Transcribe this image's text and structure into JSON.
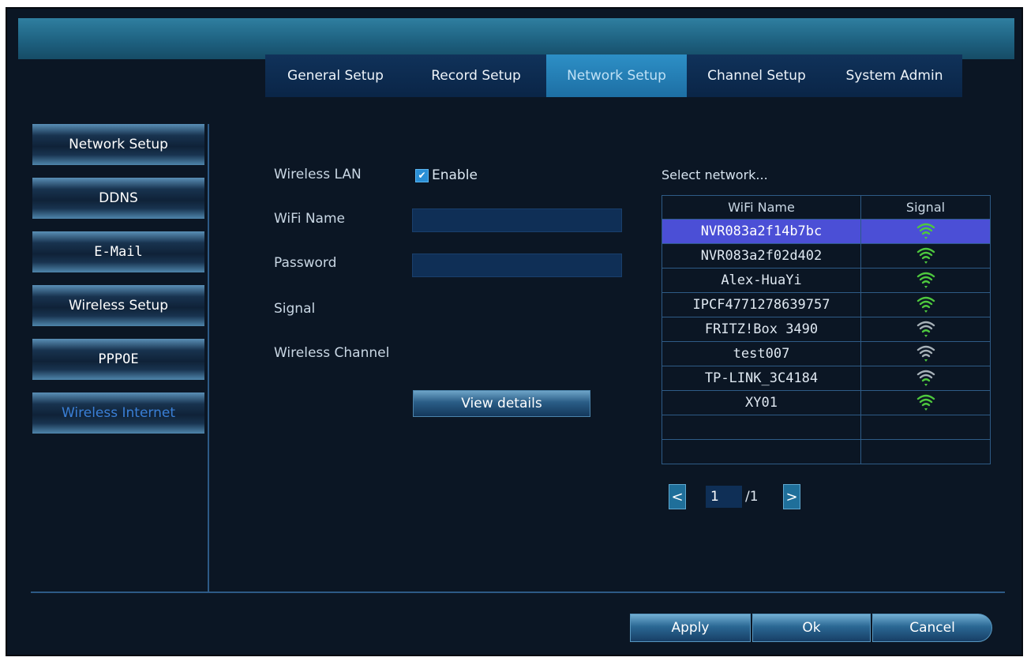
{
  "tabs": [
    {
      "label": "General Setup",
      "active": false
    },
    {
      "label": "Record Setup",
      "active": false
    },
    {
      "label": "Network Setup",
      "active": true
    },
    {
      "label": "Channel Setup",
      "active": false
    },
    {
      "label": "System Admin",
      "active": false
    }
  ],
  "sidebar": {
    "items": [
      {
        "label": "Network Setup",
        "active": false
      },
      {
        "label": "DDNS",
        "active": false
      },
      {
        "label": "E-Mail",
        "active": false
      },
      {
        "label": "Wireless Setup",
        "active": false
      },
      {
        "label": "PPPOE",
        "active": false
      },
      {
        "label": "Wireless Internet",
        "active": true
      }
    ]
  },
  "form": {
    "wireless_lan_label": "Wireless LAN",
    "enable_label": "Enable",
    "enable_checked": true,
    "wifi_name_label": "WiFi Name",
    "wifi_name_value": "",
    "password_label": "Password",
    "password_value": "",
    "signal_label": "Signal",
    "wireless_channel_label": "Wireless Channel",
    "view_details_label": "View details"
  },
  "network_list": {
    "title": "Select network...",
    "headers": {
      "name": "WiFi Name",
      "signal": "Signal"
    },
    "rows": [
      {
        "name": "NVR083a2f14b7bc",
        "signal": 4,
        "selected": true
      },
      {
        "name": "NVR083a2f02d402",
        "signal": 4,
        "selected": false
      },
      {
        "name": "Alex-HuaYi",
        "signal": 4,
        "selected": false
      },
      {
        "name": "IPCF4771278639757",
        "signal": 4,
        "selected": false
      },
      {
        "name": "FRITZ!Box 3490",
        "signal": 2,
        "selected": false
      },
      {
        "name": "test007",
        "signal": 1,
        "selected": false
      },
      {
        "name": "TP-LINK_3C4184",
        "signal": 2,
        "selected": false
      },
      {
        "name": "XY01",
        "signal": 4,
        "selected": false
      },
      {
        "name": "",
        "signal": 0,
        "selected": false
      },
      {
        "name": "",
        "signal": 0,
        "selected": false
      }
    ]
  },
  "pagination": {
    "prev": "<",
    "next": ">",
    "current": "1",
    "total": "/1"
  },
  "buttons": {
    "apply": "Apply",
    "ok": "Ok",
    "cancel": "Cancel"
  },
  "colors": {
    "signal_on": "#4ec83e",
    "signal_off": "#a7b1b8",
    "selected_row": "#4b4fd6",
    "active_tab": "#2d8fc6"
  },
  "icons": {
    "wifi": "wifi-signal-icon",
    "check": "checkmark-icon"
  }
}
